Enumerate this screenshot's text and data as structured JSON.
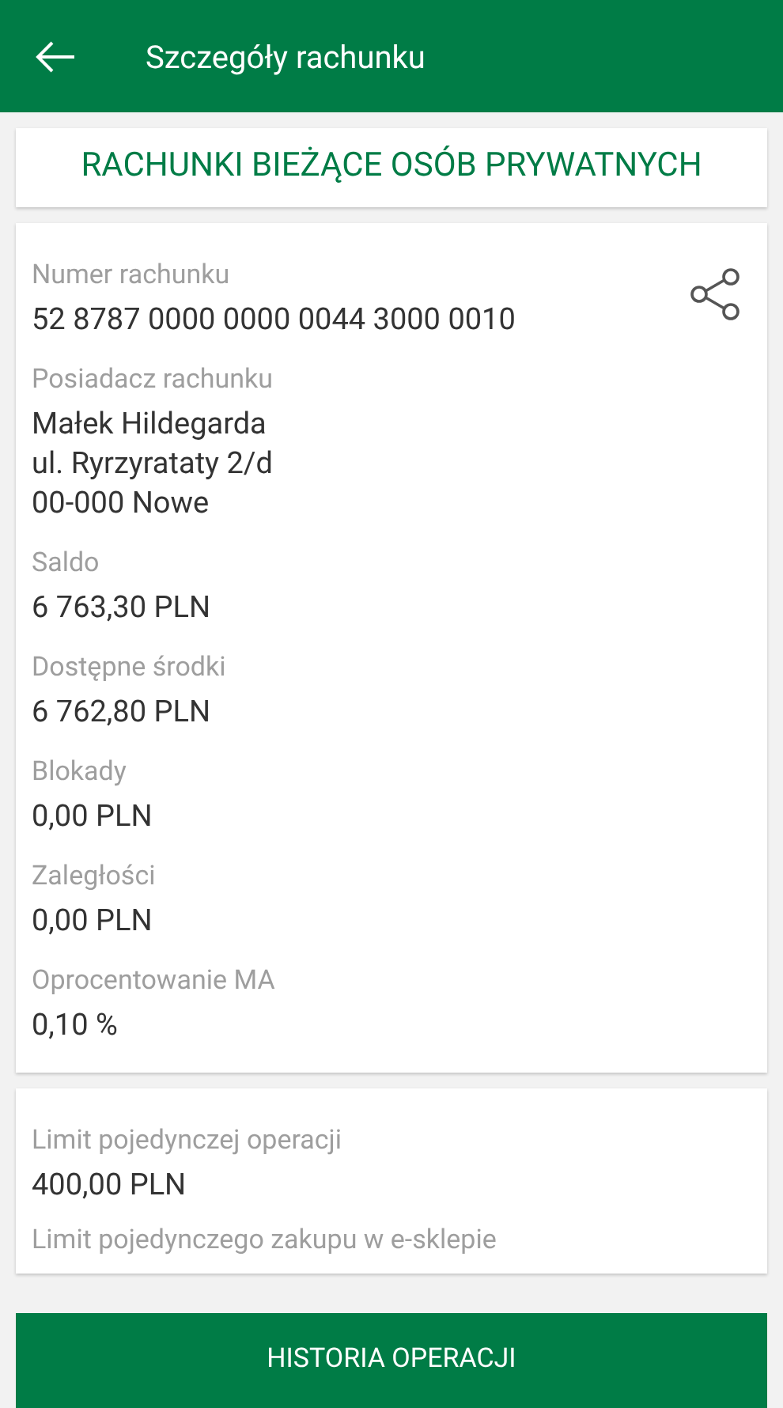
{
  "header": {
    "title": "Szczegóły rachunku"
  },
  "account_type": "RACHUNKI BIEŻĄCE OSÓB PRYWATNYCH",
  "details": [
    {
      "label": "Numer rachunku",
      "value": "52 8787 0000 0000 0044 3000 0010",
      "kind": "shareable"
    },
    {
      "label": "Posiadacz rachunku",
      "value": "Małek Hildegarda\nul. Ryrzyrataty 2/d\n00-000 Nowe",
      "kind": "plain"
    },
    {
      "label": "Saldo",
      "value": "6 763,30 PLN",
      "kind": "plain"
    },
    {
      "label": "Dostępne środki",
      "value": "6 762,80 PLN",
      "kind": "plain"
    },
    {
      "label": "Blokady",
      "value": "0,00 PLN",
      "kind": "plain"
    },
    {
      "label": "Zaległości",
      "value": "0,00 PLN",
      "kind": "plain"
    },
    {
      "label": "Oprocentowanie MA",
      "value": "0,10 %",
      "kind": "plain"
    }
  ],
  "limits": [
    {
      "label": "Limit pojedynczej operacji",
      "value": "400,00 PLN"
    },
    {
      "label": "Limit pojedynczego zakupu w e-sklepie"
    }
  ],
  "history_button": "HISTORIA OPERACJI"
}
